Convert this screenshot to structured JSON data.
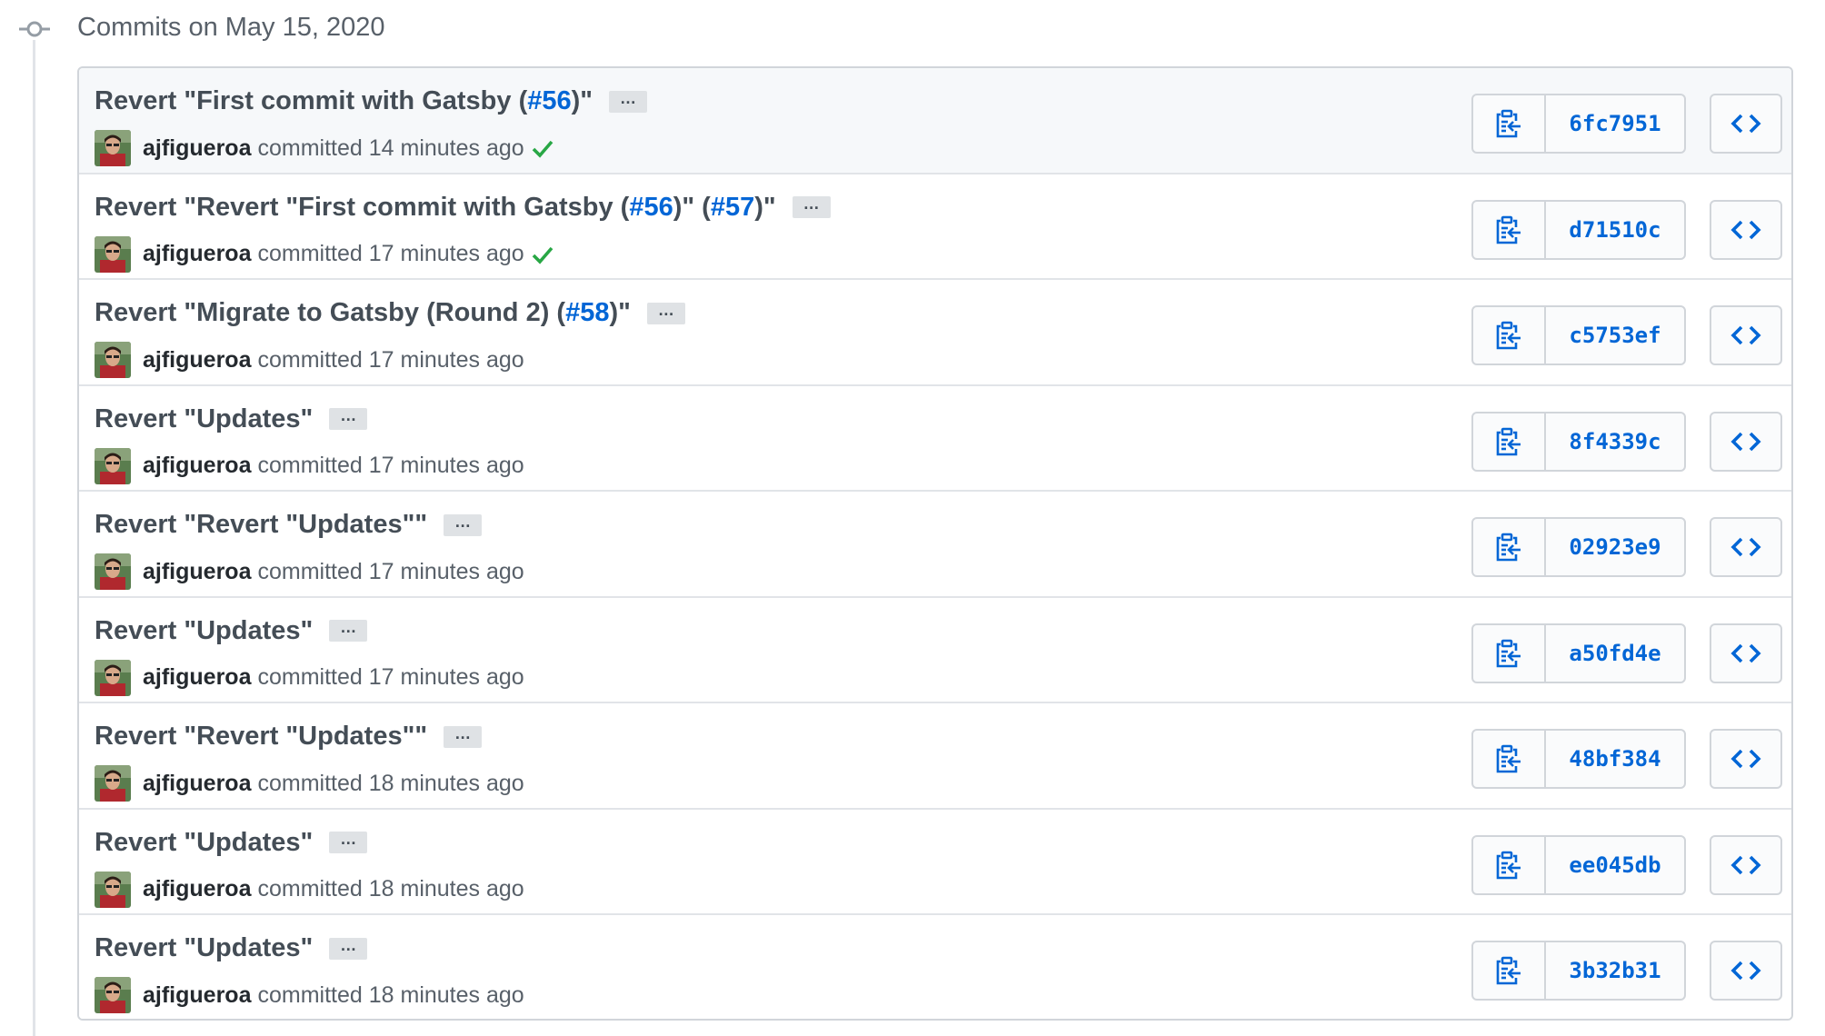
{
  "group_title": "Commits on May 15, 2020",
  "colors": {
    "link": "#0366d6",
    "success": "#28a745",
    "border": "#d1d5da"
  },
  "commits": [
    {
      "parts": [
        {
          "text": "Revert \"First commit with Gatsby (",
          "link": false
        },
        {
          "text": "#56",
          "link": true
        },
        {
          "text": ")\"",
          "link": false
        }
      ],
      "ellipsis": "…",
      "author": "ajfigueroa",
      "committed": "committed 14 minutes ago",
      "verified": true,
      "sha": "6fc7951",
      "highlight": true
    },
    {
      "parts": [
        {
          "text": "Revert \"Revert \"First commit with Gatsby (",
          "link": false
        },
        {
          "text": "#56",
          "link": true
        },
        {
          "text": ")\" (",
          "link": false
        },
        {
          "text": "#57",
          "link": true
        },
        {
          "text": ")\"",
          "link": false
        }
      ],
      "ellipsis": "…",
      "author": "ajfigueroa",
      "committed": "committed 17 minutes ago",
      "verified": true,
      "sha": "d71510c",
      "highlight": false
    },
    {
      "parts": [
        {
          "text": "Revert \"Migrate to Gatsby (Round 2) (",
          "link": false
        },
        {
          "text": "#58",
          "link": true
        },
        {
          "text": ")\"",
          "link": false
        }
      ],
      "ellipsis": "…",
      "author": "ajfigueroa",
      "committed": "committed 17 minutes ago",
      "verified": false,
      "sha": "c5753ef",
      "highlight": false
    },
    {
      "parts": [
        {
          "text": "Revert \"Updates\"",
          "link": false
        }
      ],
      "ellipsis": "…",
      "author": "ajfigueroa",
      "committed": "committed 17 minutes ago",
      "verified": false,
      "sha": "8f4339c",
      "highlight": false
    },
    {
      "parts": [
        {
          "text": "Revert \"Revert \"Updates\"\"",
          "link": false
        }
      ],
      "ellipsis": "…",
      "author": "ajfigueroa",
      "committed": "committed 17 minutes ago",
      "verified": false,
      "sha": "02923e9",
      "highlight": false
    },
    {
      "parts": [
        {
          "text": "Revert \"Updates\"",
          "link": false
        }
      ],
      "ellipsis": "…",
      "author": "ajfigueroa",
      "committed": "committed 17 minutes ago",
      "verified": false,
      "sha": "a50fd4e",
      "highlight": false
    },
    {
      "parts": [
        {
          "text": "Revert \"Revert \"Updates\"\"",
          "link": false
        }
      ],
      "ellipsis": "…",
      "author": "ajfigueroa",
      "committed": "committed 18 minutes ago",
      "verified": false,
      "sha": "48bf384",
      "highlight": false
    },
    {
      "parts": [
        {
          "text": "Revert \"Updates\"",
          "link": false
        }
      ],
      "ellipsis": "…",
      "author": "ajfigueroa",
      "committed": "committed 18 minutes ago",
      "verified": false,
      "sha": "ee045db",
      "highlight": false
    },
    {
      "parts": [
        {
          "text": "Revert \"Updates\"",
          "link": false
        }
      ],
      "ellipsis": "…",
      "author": "ajfigueroa",
      "committed": "committed 18 minutes ago",
      "verified": false,
      "sha": "3b32b31",
      "highlight": false
    }
  ]
}
